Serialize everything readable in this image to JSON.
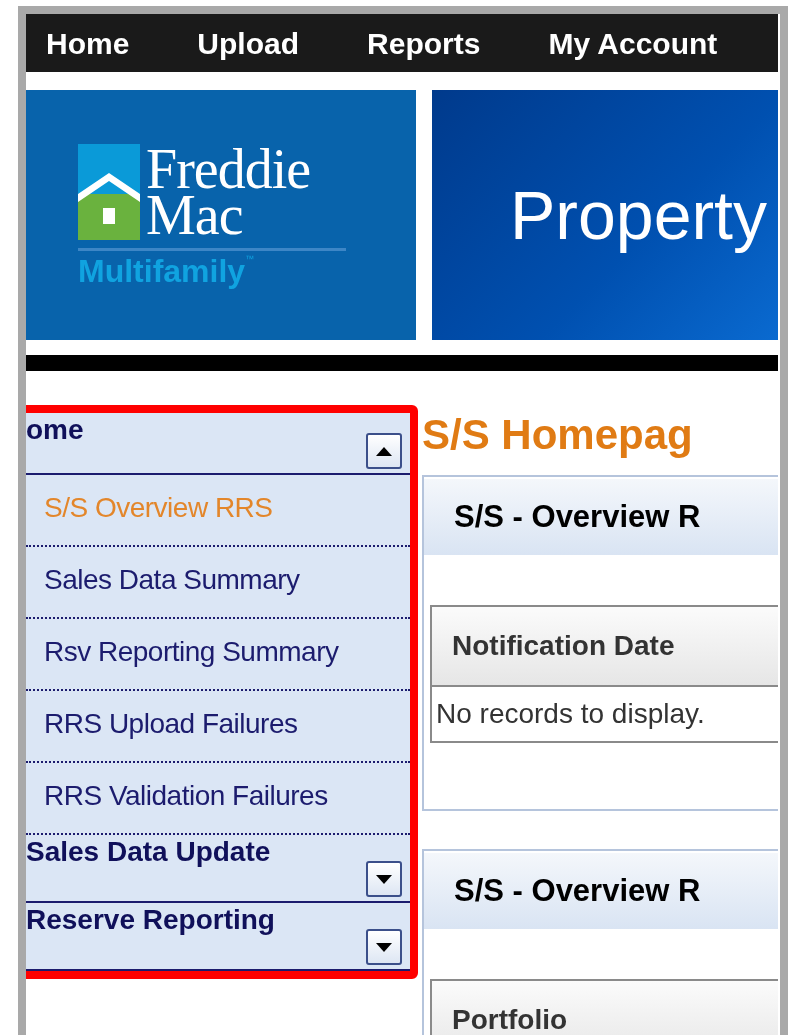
{
  "nav": [
    "Home",
    "Upload",
    "Reports",
    "My Account"
  ],
  "banner": {
    "logo": {
      "line1": "Freddie",
      "line2": "Mac",
      "tagline": "Multifamily",
      "mark": "™"
    },
    "title": "Property"
  },
  "sidebar": {
    "sections": [
      {
        "label": "ome",
        "expanded": true,
        "items": [
          {
            "label": "S/S Overview RRS",
            "selected": true
          },
          {
            "label": "Sales Data Summary",
            "selected": false
          },
          {
            "label": "Rsv Reporting Summary",
            "selected": false
          },
          {
            "label": "RRS Upload Failures",
            "selected": false
          },
          {
            "label": "RRS Validation Failures",
            "selected": false
          }
        ]
      },
      {
        "label": "Sales Data Update",
        "expanded": false
      },
      {
        "label": "Reserve Reporting",
        "expanded": false
      }
    ]
  },
  "page_title": "S/S Homepag",
  "panels": [
    {
      "title": "S/S - Overview R",
      "table": {
        "columns": [
          "Notification Date"
        ],
        "empty_message": "No records to display."
      }
    },
    {
      "title": "S/S - Overview R",
      "table": {
        "columns": [
          "Portfolio"
        ]
      }
    }
  ]
}
